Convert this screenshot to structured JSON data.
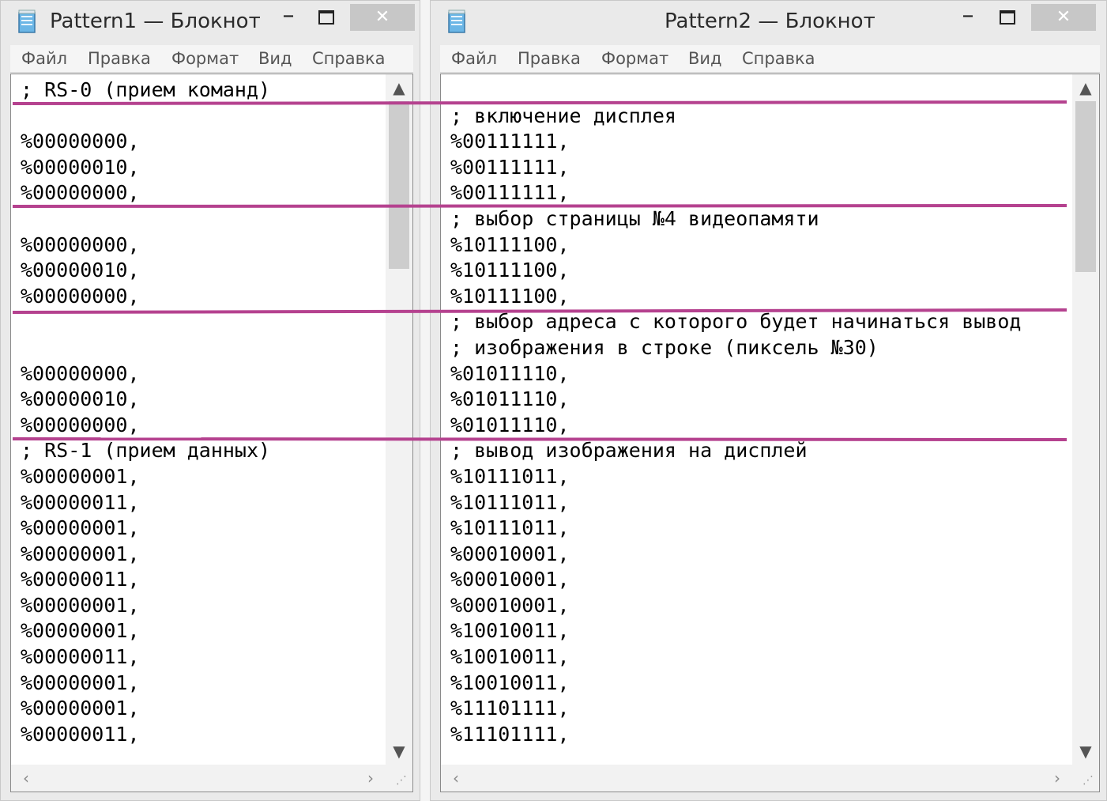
{
  "accent_line_color": "#b5428f",
  "window1": {
    "title": "Pattern1 — Блокнот",
    "minimize_glyph": "–",
    "close_glyph": "✕",
    "menu": [
      "Файл",
      "Правка",
      "Формат",
      "Вид",
      "Справка"
    ],
    "lines": [
      "; RS-0 (прием команд)",
      "",
      "%00000000,",
      "%00000010,",
      "%00000000,",
      "",
      "%00000000,",
      "%00000010,",
      "%00000000,",
      "",
      "",
      "%00000000,",
      "%00000010,",
      "%00000000,",
      "; RS-1 (прием данных)",
      "%00000001,",
      "%00000011,",
      "%00000001,",
      "%00000001,",
      "%00000011,",
      "%00000001,",
      "%00000001,",
      "%00000011,",
      "%00000001,",
      "%00000001,",
      "%00000011,"
    ]
  },
  "window2": {
    "title": "Pattern2 — Блокнот",
    "minimize_glyph": "–",
    "close_glyph": "✕",
    "menu": [
      "Файл",
      "Правка",
      "Формат",
      "Вид",
      "Справка"
    ],
    "lines": [
      "",
      "; включение дисплея",
      "%00111111,",
      "%00111111,",
      "%00111111,",
      "; выбор страницы №4 видеопамяти",
      "%10111100,",
      "%10111100,",
      "%10111100,",
      "; выбор адреса с которого будет начинаться вывод",
      "; изображения в строке (пиксель №30)",
      "%01011110,",
      "%01011110,",
      "%01011110,",
      "; вывод изображения на дисплей",
      "%10111011,",
      "%10111011,",
      "%10111011,",
      "%00010001,",
      "%00010001,",
      "%00010001,",
      "%10010011,",
      "%10010011,",
      "%10010011,",
      "%11101111,",
      "%11101111,"
    ]
  },
  "icons": {
    "app": "notepad-icon",
    "scroll_up": "▲",
    "scroll_down": "▼",
    "scroll_left": "‹",
    "scroll_right": "›"
  }
}
